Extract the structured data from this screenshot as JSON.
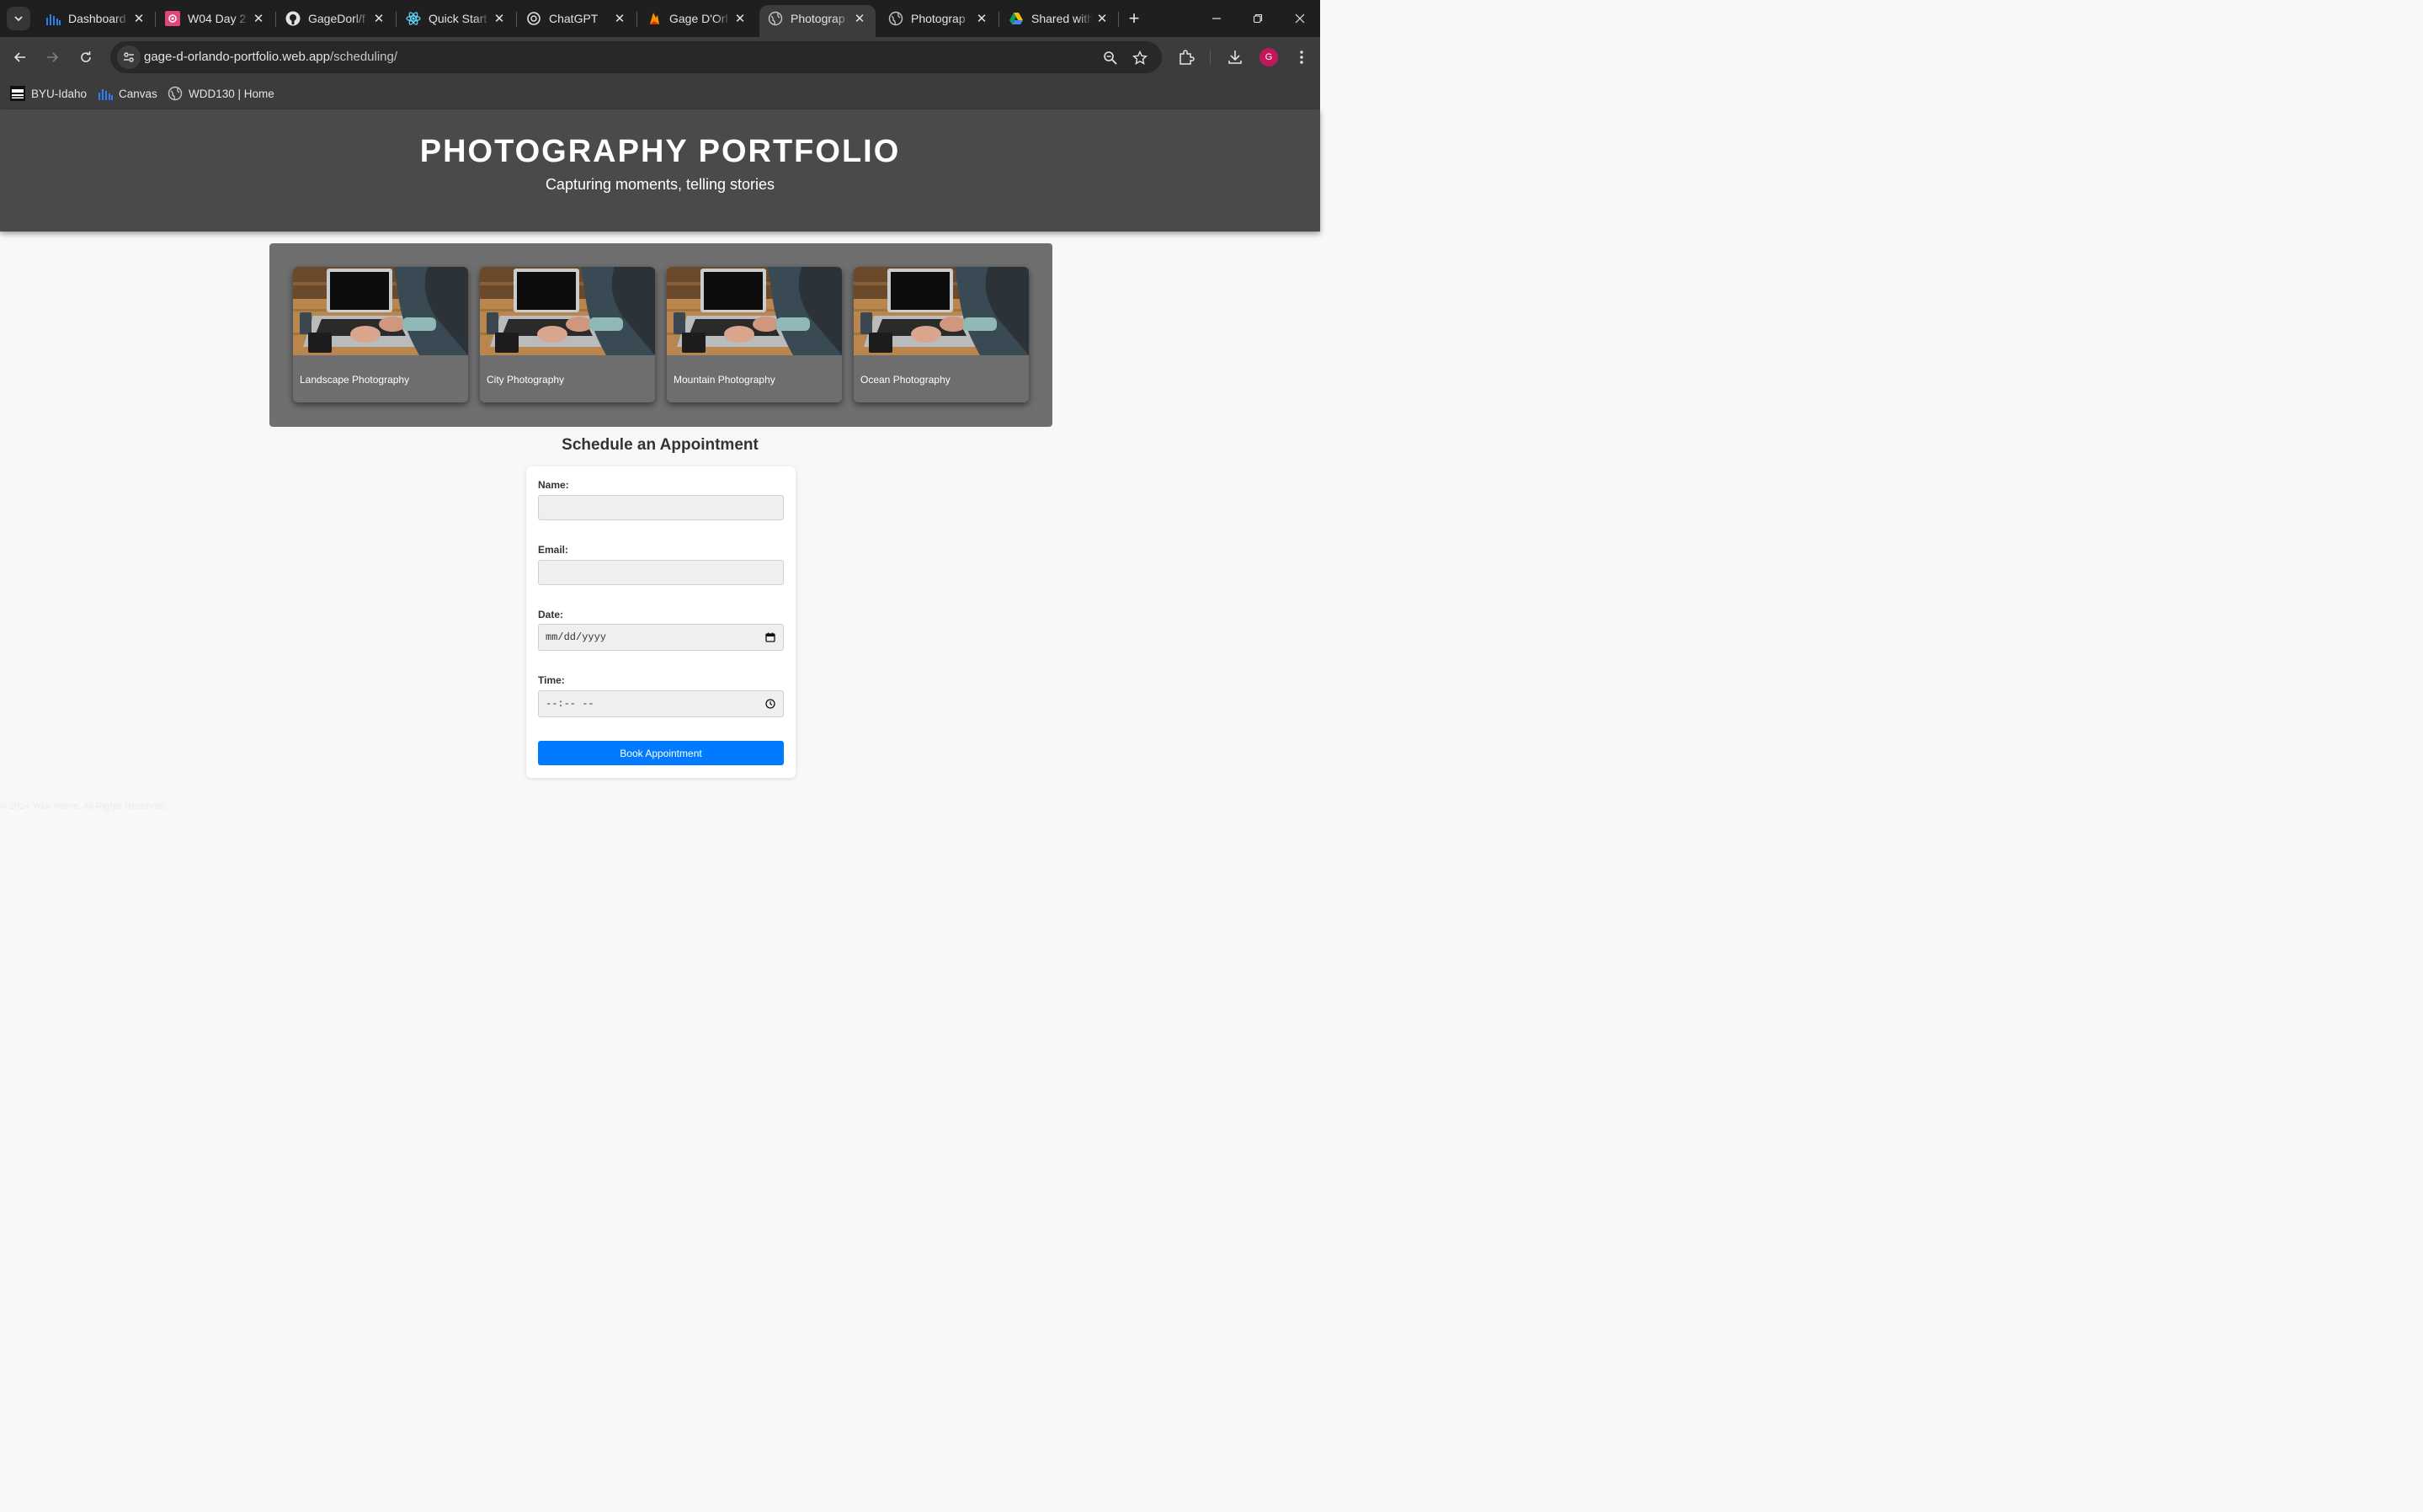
{
  "browser": {
    "tabs": [
      {
        "title": "Dashboard",
        "icon": "canvas-bars-icon"
      },
      {
        "title": "W04 Day 2",
        "icon": "pink-flower-icon"
      },
      {
        "title": "GageDorl/f",
        "icon": "github-icon"
      },
      {
        "title": "Quick Start",
        "icon": "react-icon"
      },
      {
        "title": "ChatGPT",
        "icon": "openai-icon"
      },
      {
        "title": "Gage D'Orl",
        "icon": "firebase-icon"
      },
      {
        "title": "Photograp",
        "icon": "globe-icon",
        "active": true
      },
      {
        "title": "Photograp",
        "icon": "globe-icon"
      },
      {
        "title": "Shared with",
        "icon": "google-drive-icon"
      }
    ],
    "url": {
      "host": "gage-d-orlando-portfolio.web.app",
      "path": "/scheduling/"
    },
    "avatar_letter": "G",
    "bookmarks": [
      {
        "label": "BYU-Idaho",
        "icon": "byu-idaho-icon"
      },
      {
        "label": "Canvas",
        "icon": "canvas-bars-icon"
      },
      {
        "label": "WDD130 | Home",
        "icon": "globe-icon"
      }
    ]
  },
  "header": {
    "title": "PHOTOGRAPHY PORTFOLIO",
    "tagline": "Capturing moments, telling stories"
  },
  "gallery": [
    {
      "caption": "Landscape Photography"
    },
    {
      "caption": "City Photography"
    },
    {
      "caption": "Mountain Photography"
    },
    {
      "caption": "Ocean Photography"
    }
  ],
  "schedule": {
    "heading": "Schedule an Appointment",
    "name_label": "Name:",
    "name_value": "",
    "email_label": "Email:",
    "email_value": "",
    "date_label": "Date:",
    "date_value": "mm/dd/yyyy",
    "time_label": "Time:",
    "time_value": "--:-- --",
    "submit_label": "Book Appointment"
  },
  "footer": {
    "text": "© 2024 Your Name. All Rights Reserved."
  },
  "colors": {
    "header_bg": "#4a4a4a",
    "gallery_bg": "#6f6f6f",
    "button_bg": "#007bff",
    "page_bg": "#f8f8f8"
  }
}
